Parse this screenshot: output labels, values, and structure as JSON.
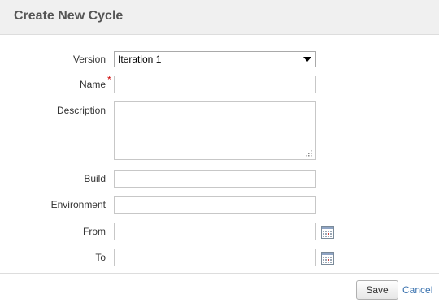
{
  "dialog": {
    "title": "Create New Cycle"
  },
  "form": {
    "version": {
      "label": "Version",
      "selected": "Iteration 1"
    },
    "name": {
      "label": "Name",
      "required_marker": "*",
      "value": ""
    },
    "description": {
      "label": "Description",
      "value": ""
    },
    "build": {
      "label": "Build",
      "value": ""
    },
    "environment": {
      "label": "Environment",
      "value": ""
    },
    "from": {
      "label": "From",
      "value": "",
      "icon": "calendar-icon"
    },
    "to": {
      "label": "To",
      "value": "",
      "icon": "calendar-icon"
    }
  },
  "footer": {
    "save_label": "Save",
    "cancel_label": "Cancel"
  },
  "colors": {
    "header_bg": "#f0f0f0",
    "required": "#cc0000",
    "link": "#3b73af"
  }
}
